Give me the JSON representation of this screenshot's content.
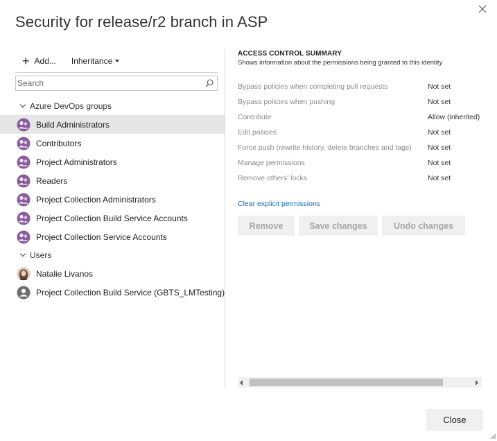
{
  "dialog": {
    "title": "Security for release/r2 branch in ASP",
    "close_button": "Close"
  },
  "toolbar": {
    "add_label": "Add...",
    "inheritance_label": "Inheritance"
  },
  "search": {
    "placeholder": "Search"
  },
  "tree": {
    "groups_header": "Azure DevOps groups",
    "groups": [
      {
        "label": "Build Administrators",
        "selected": true
      },
      {
        "label": "Contributors"
      },
      {
        "label": "Project Administrators"
      },
      {
        "label": "Readers"
      },
      {
        "label": "Project Collection Administrators"
      },
      {
        "label": "Project Collection Build Service Accounts"
      },
      {
        "label": "Project Collection Service Accounts"
      }
    ],
    "users_header": "Users",
    "users": [
      {
        "label": "Natalie Livanos",
        "icon": "user-photo-icon"
      },
      {
        "label": "Project Collection Build Service (GBTS_LMTesting)",
        "icon": "service-account-icon"
      }
    ]
  },
  "summary": {
    "title": "ACCESS CONTROL SUMMARY",
    "subtitle": "Shows information about the permissions being granted to this identity",
    "permissions": [
      {
        "name": "Bypass policies when completing pull requests",
        "value": "Not set"
      },
      {
        "name": "Bypass policies when pushing",
        "value": "Not set"
      },
      {
        "name": "Contribute",
        "value": "Allow (inherited)"
      },
      {
        "name": "Edit policies",
        "value": "Not set"
      },
      {
        "name": "Force push (rewrite history, delete branches and tags)",
        "value": "Not set"
      },
      {
        "name": "Manage permissions",
        "value": "Not set"
      },
      {
        "name": "Remove others' locks",
        "value": "Not set"
      }
    ],
    "clear_link": "Clear explicit permissions",
    "buttons": {
      "remove": "Remove",
      "save": "Save changes",
      "undo": "Undo changes"
    }
  },
  "colors": {
    "group_icon": "#8a5c9e",
    "link": "#106ebe",
    "selected_row": "#e6e6e6"
  }
}
